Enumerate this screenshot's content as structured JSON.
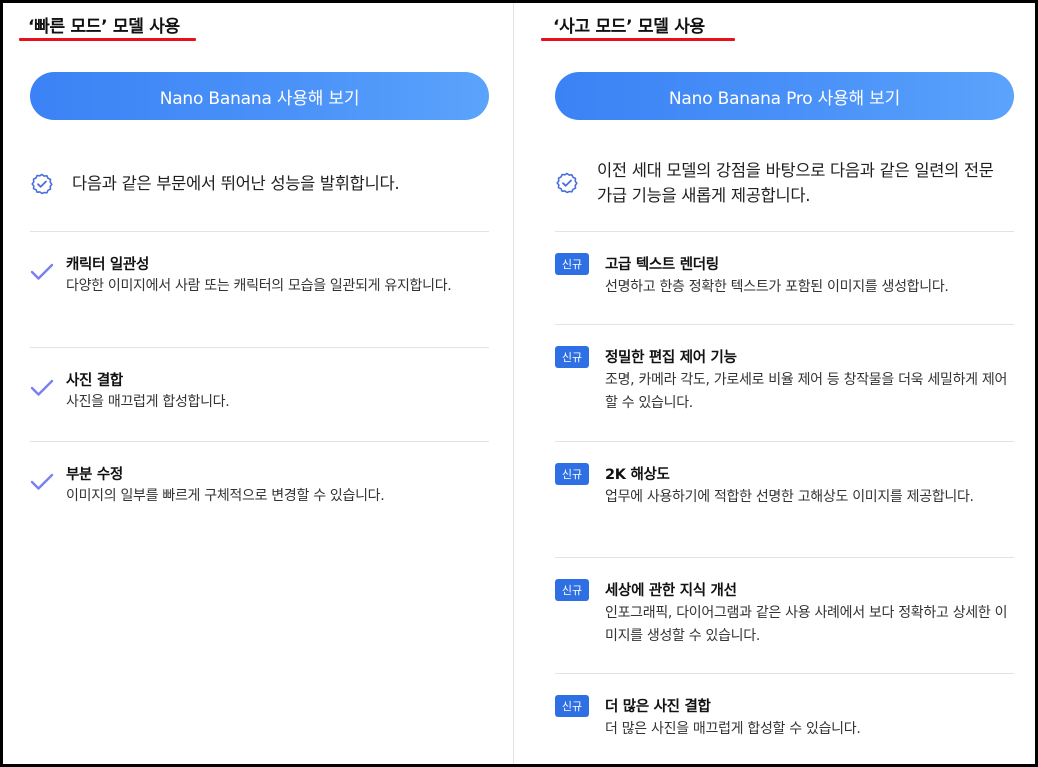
{
  "left": {
    "title": "‘빠른 모드’ 모델 사용",
    "button_label": "Nano Banana 사용해 보기",
    "intro": "다음과 같은 부문에서 뛰어난 성능을 발휘합니다.",
    "features": [
      {
        "title": "캐릭터 일관성",
        "desc": "다양한 이미지에서 사람 또는 캐릭터의 모습을 일관되게 유지합니다."
      },
      {
        "title": "사진 결합",
        "desc": "사진을 매끄럽게 합성합니다."
      },
      {
        "title": "부분 수정",
        "desc": "이미지의 일부를 빠르게 구체적으로 변경할 수 있습니다."
      }
    ]
  },
  "right": {
    "title": "‘사고 모드’ 모델 사용",
    "button_label": "Nano Banana Pro 사용해 보기",
    "intro": "이전 세대 모델의 강점을 바탕으로 다음과 같은 일련의 전문가급 기능을 새롭게 제공합니다.",
    "features": [
      {
        "badge": "신규",
        "title": "고급 텍스트 렌더링",
        "desc": "선명하고 한층 정확한 텍스트가 포함된 이미지를 생성합니다."
      },
      {
        "badge": "신규",
        "title": "정밀한 편집 제어 기능",
        "desc": "조명, 카메라 각도, 가로세로 비율 제어 등 창작물을 더욱 세밀하게 제어할 수 있습니다."
      },
      {
        "badge": "신규",
        "title": "2K 해상도",
        "desc": "업무에 사용하기에 적합한 선명한 고해상도 이미지를 제공합니다."
      },
      {
        "badge": "신규",
        "title": "세상에 관한 지식 개선",
        "desc": "인포그래픽, 다이어그램과 같은 사용 사례에서 보다 정확하고 상세한 이미지를 생성할 수 있습니다."
      },
      {
        "badge": "신규",
        "title": "더 많은 사진 결합",
        "desc": "더 많은 사진을 매끄럽게 합성할 수 있습니다."
      }
    ]
  },
  "colors": {
    "accent_red": "#e8101a",
    "button_gradient_start": "#3b82f6",
    "button_gradient_end": "#5ba3fb",
    "badge_blue": "#2f6fe4",
    "check_purple": "#7b7ff0"
  },
  "icons": {
    "intro": "verified-badge-icon",
    "feature_left": "checkmark-icon"
  }
}
